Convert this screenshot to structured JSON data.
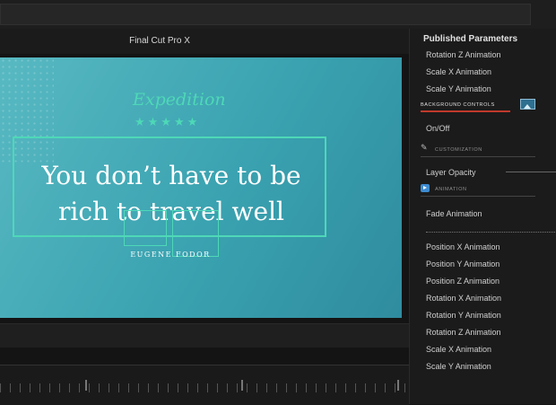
{
  "app": {
    "title": "Final Cut Pro X"
  },
  "canvas": {
    "brand": "Expedition",
    "stars": "★★★★★",
    "quote_line1": "You don’t have to be",
    "quote_line2": "rich to travel well",
    "author": "EUGENE FODOR"
  },
  "panel": {
    "title": "Published Parameters",
    "top_params": [
      "Rotation Z Animation",
      "Scale X Animation",
      "Scale Y Animation"
    ],
    "background_controls": "BACKGROUND CONTROLS",
    "on_off": "On/Off",
    "customization": "CUSTOMIZATION",
    "layer_opacity": "Layer Opacity",
    "animation": "ANIMATION",
    "fade_animation": "Fade Animation",
    "bottom_params": [
      "Position X Animation",
      "Position Y Animation",
      "Position Z Animation",
      "Rotation X Animation",
      "Rotation Y Animation",
      "Rotation Z Animation",
      "Scale X Animation",
      "Scale Y Animation"
    ]
  },
  "icons": {
    "background_image": "image-icon",
    "customization": "pencil-icon",
    "animation": "play-icon"
  },
  "colors": {
    "accent": "#4ed8b7",
    "canvas": "#3aa2b0",
    "highlight": "#c0392b"
  }
}
